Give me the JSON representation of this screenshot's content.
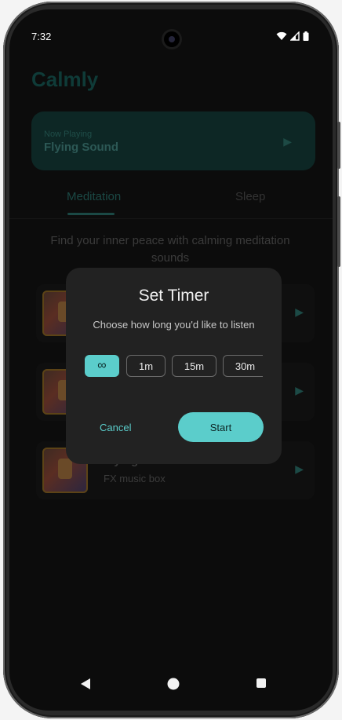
{
  "status": {
    "time": "7:32"
  },
  "app": {
    "title": "Calmly",
    "now_playing": {
      "label": "Now Playing",
      "title": "Flying Sound"
    },
    "tabs": [
      {
        "label": "Meditation",
        "active": true
      },
      {
        "label": "Sleep",
        "active": false
      }
    ],
    "subtitle": "Find your inner peace with calming meditation sounds",
    "tracks": [
      {
        "name": "",
        "artist": ""
      },
      {
        "name": "",
        "artist": ""
      },
      {
        "name": "Flying Deer",
        "artist": "FX music box"
      }
    ]
  },
  "dialog": {
    "title": "Set Timer",
    "subtitle": "Choose how long you'd like to listen",
    "options": [
      {
        "label": "∞",
        "selected": true
      },
      {
        "label": "1m",
        "selected": false
      },
      {
        "label": "15m",
        "selected": false
      },
      {
        "label": "30m",
        "selected": false
      }
    ],
    "cancel_label": "Cancel",
    "start_label": "Start"
  },
  "colors": {
    "accent": "#5bcdcb",
    "dialog_bg": "#222222",
    "screen_bg": "#0c0c0c"
  }
}
